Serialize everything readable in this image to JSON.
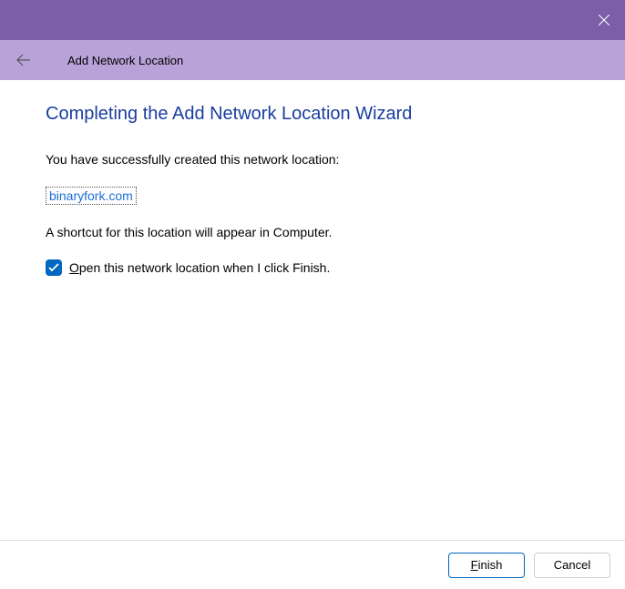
{
  "header": {
    "title": "Add Network Location"
  },
  "content": {
    "wizard_title": "Completing the Add Network Location Wizard",
    "success_text": "You have successfully created this network location:",
    "location_link": "binaryfork.com",
    "shortcut_text": "A shortcut for this location will appear in Computer.",
    "checkbox_label_prefix": "O",
    "checkbox_label_rest": "pen this network location when I click Finish.",
    "checkbox_checked": true
  },
  "footer": {
    "finish_prefix": "F",
    "finish_rest": "inish",
    "cancel_label": "Cancel"
  }
}
